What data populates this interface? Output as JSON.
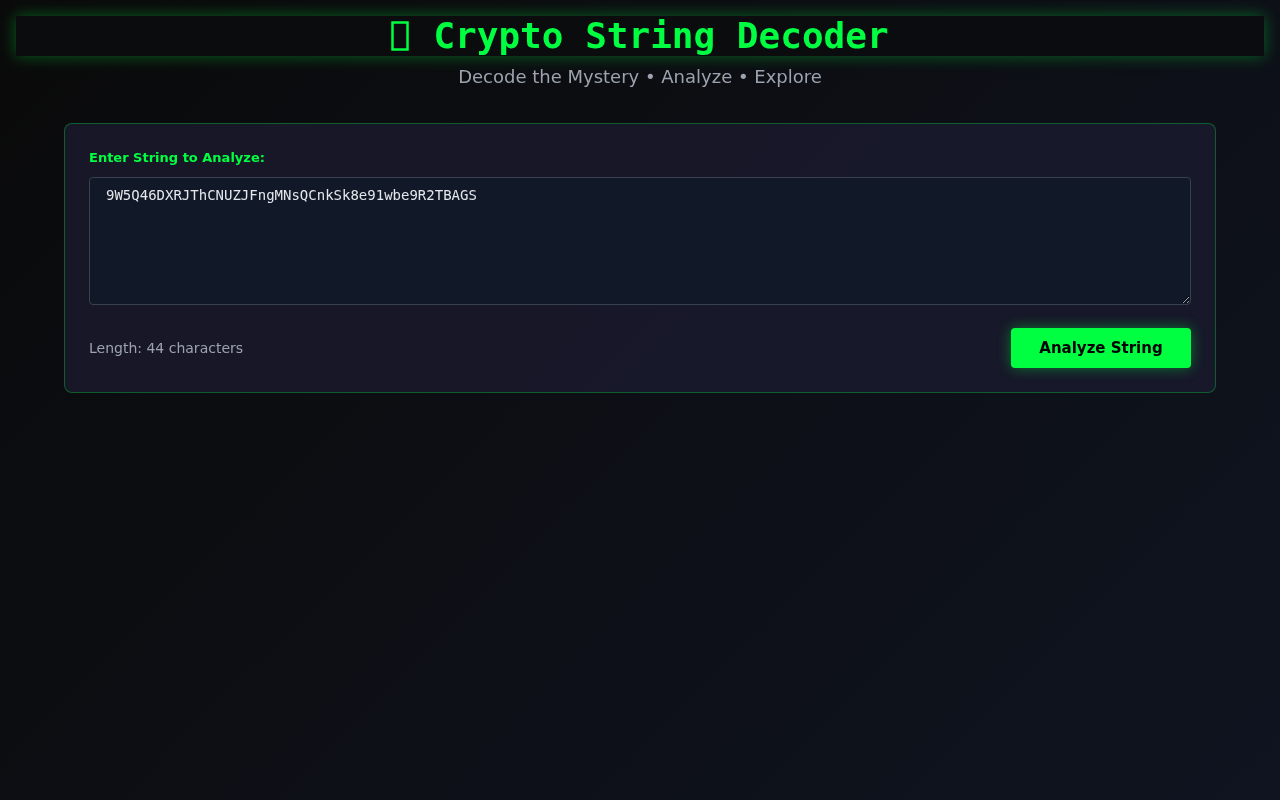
{
  "header": {
    "title": "Crypto String Decoder",
    "subtitle": "Decode the Mystery • Analyze • Explore"
  },
  "input_card": {
    "label": "Enter String to Analyze:",
    "value": "9W5Q46DXRJThCNUZJFngMNsQCnkSk8e91wbe9R2TBAGS",
    "length_text": "Length: 44 characters",
    "button": "Analyze String"
  }
}
